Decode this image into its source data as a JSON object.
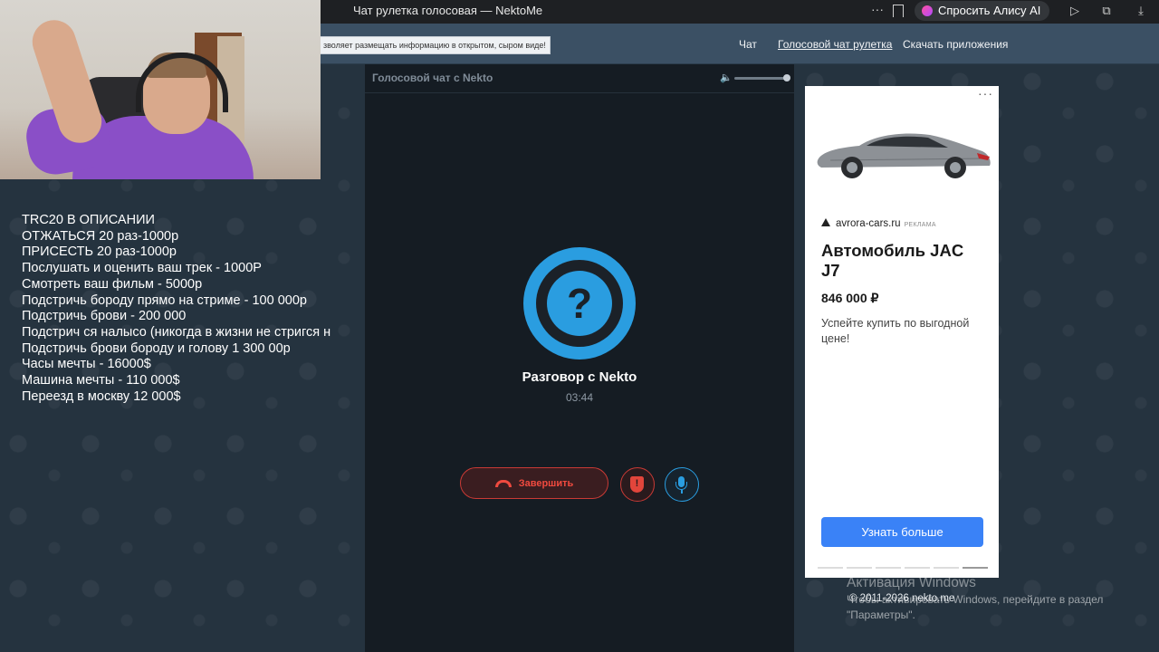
{
  "browser": {
    "tab_title": "Чат рулетка голосовая — NektoMe",
    "more_label": "···",
    "alice_label": "Спросить Алису AI"
  },
  "header": {
    "notice": "зволяет размещать информацию в открытом, сыром виде!",
    "nav": [
      {
        "label": "Чат",
        "active": false
      },
      {
        "label": "Голосовой чат рулетка",
        "active": true
      },
      {
        "label": "Скачать приложения",
        "active": false
      }
    ]
  },
  "overlay": {
    "lines": [
      "TRC20 В ОПИСАНИИ",
      "ОТЖАТЬСЯ 20 раз-1000р",
      "ПРИСЕСТЬ 20 раз-1000р",
      "Послушать и оценить ваш трек - 1000Р",
      "Смотреть ваш фильм - 5000р",
      "Подстричь бороду прямо на стриме - 100 000р",
      "Подстричь брови - 200 000",
      "Подстрич ся налысо (никогда в жизни не стригся н",
      "Подстричь брови бороду и голову 1 300 00р",
      "Часы мечты - 16000$",
      "Машина мечты - 110 000$",
      "Переезд в москву 12 000$"
    ]
  },
  "chat": {
    "title": "Голосовой чат с Nekto",
    "volume_level": 1.0,
    "avatar_symbol": "?",
    "conversation_title": "Разговор с Nekto",
    "timer": "03:44",
    "end_label": "Завершить",
    "report_symbol": "!",
    "accent_color": "#2a9de0",
    "danger_color": "#e2453b"
  },
  "ad": {
    "menu": "···",
    "domain": "avrora-cars.ru",
    "label": "РЕКЛАМА",
    "title": "Автомобиль JAC J7",
    "price": "846 000 ₽",
    "description": "Успейте купить по выгодной цене!",
    "cta": "Узнать больше",
    "cta_color": "#3a82f7",
    "slides": 6,
    "active_slide": 6
  },
  "watermark": {
    "title": "Активация Windows",
    "subtitle": "Чтобы активировать Windows, перейдите в раздел \"Параметры\"."
  },
  "footer": {
    "copyright": "© 2011-2026 nekto.me"
  }
}
